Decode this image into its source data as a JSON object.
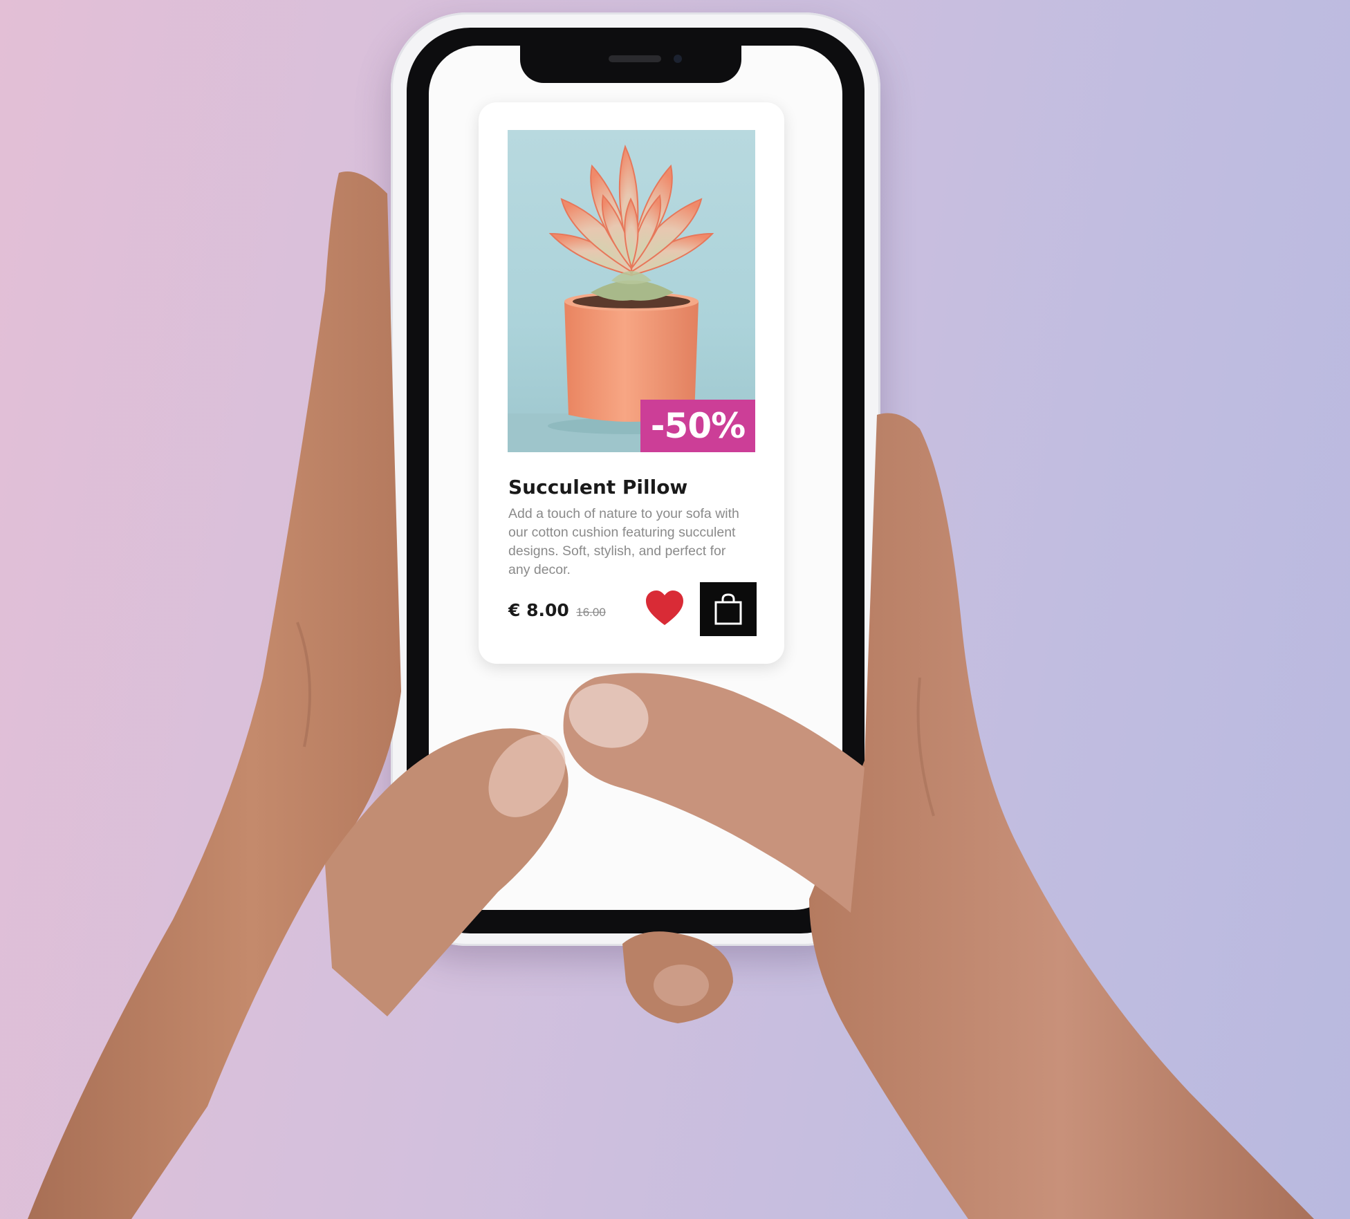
{
  "product": {
    "badge": "-50%",
    "title": "Succulent Pillow",
    "description": "Add a touch of nature to your sofa with our cotton cushion featuring succulent designs. Soft, stylish, and perfect for any decor.",
    "price_current": "€ 8.00",
    "price_old": "16.00"
  },
  "icons": {
    "wishlist": "heart-icon",
    "cart": "shopping-bag-icon"
  },
  "colors": {
    "badge": "#cc3e97",
    "heart": "#d92b36",
    "cart_button": "#0b0b0b",
    "image_background": "#b8d9df",
    "pot": "#f39a76"
  }
}
